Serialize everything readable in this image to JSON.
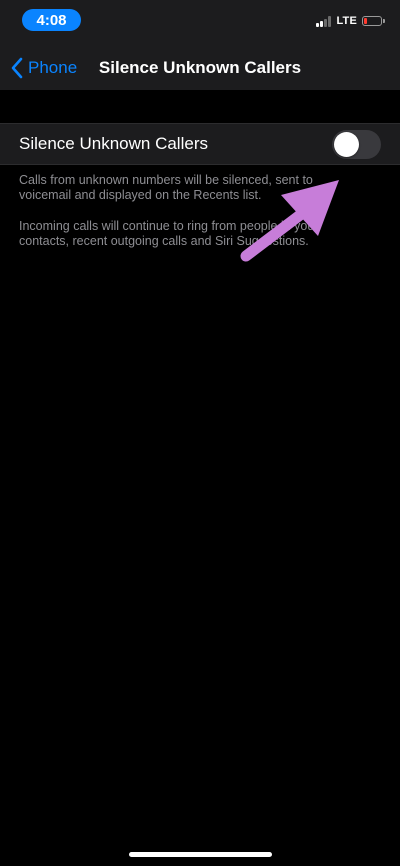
{
  "status_bar": {
    "time": "4:08",
    "network": "LTE",
    "colors": {
      "time_pill": "#0a84ff",
      "battery_level": "#ff3b30"
    }
  },
  "nav": {
    "back_label": "Phone",
    "title": "Silence Unknown Callers",
    "accent": "#0a84ff"
  },
  "setting": {
    "label": "Silence Unknown Callers",
    "toggle_on": false
  },
  "footer": {
    "line1": "Calls from unknown numbers will be silenced, sent to voicemail and displayed on the Recents list.",
    "line2": "Incoming calls will continue to ring from people in your contacts, recent outgoing calls and Siri Suggestions."
  },
  "annotation": {
    "color": "#c77dd9"
  }
}
